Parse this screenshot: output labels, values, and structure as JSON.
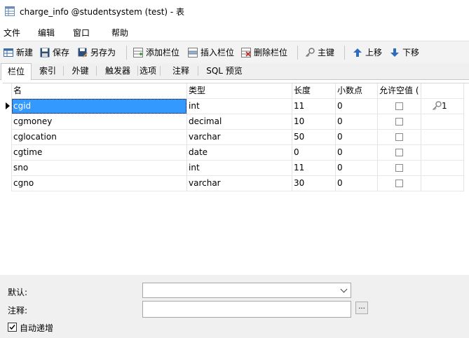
{
  "window": {
    "title": "charge_info @studentsystem (test) - 表"
  },
  "menu": [
    "文件",
    "编辑",
    "窗口",
    "帮助"
  ],
  "toolbar": {
    "new": "新建",
    "save": "保存",
    "save_as": "另存为",
    "add_field": "添加栏位",
    "insert_field": "插入栏位",
    "delete_field": "删除栏位",
    "primary_key": "主键",
    "move_up": "上移",
    "move_down": "下移"
  },
  "tabs": [
    "栏位",
    "索引",
    "外键",
    "触发器",
    "选项",
    "注释",
    "SQL 预览"
  ],
  "grid": {
    "headers": [
      "名",
      "类型",
      "长度",
      "小数点",
      "允许空值 ("
    ],
    "rows": [
      {
        "name": "cgid",
        "type": "int",
        "length": "11",
        "decimals": "0",
        "nullable": false,
        "key": "1"
      },
      {
        "name": "cgmoney",
        "type": "decimal",
        "length": "10",
        "decimals": "0",
        "nullable": false,
        "key": ""
      },
      {
        "name": "cglocation",
        "type": "varchar",
        "length": "50",
        "decimals": "0",
        "nullable": false,
        "key": ""
      },
      {
        "name": "cgtime",
        "type": "date",
        "length": "0",
        "decimals": "0",
        "nullable": false,
        "key": ""
      },
      {
        "name": "sno",
        "type": "int",
        "length": "11",
        "decimals": "0",
        "nullable": false,
        "key": ""
      },
      {
        "name": "cgno",
        "type": "varchar",
        "length": "30",
        "decimals": "0",
        "nullable": false,
        "key": ""
      }
    ]
  },
  "props": {
    "default_label": "默认:",
    "default_value": "",
    "comment_label": "注释:",
    "comment_value": "",
    "browse_label": "...",
    "auto_increment_label": "自动递增",
    "auto_increment_checked": true
  }
}
